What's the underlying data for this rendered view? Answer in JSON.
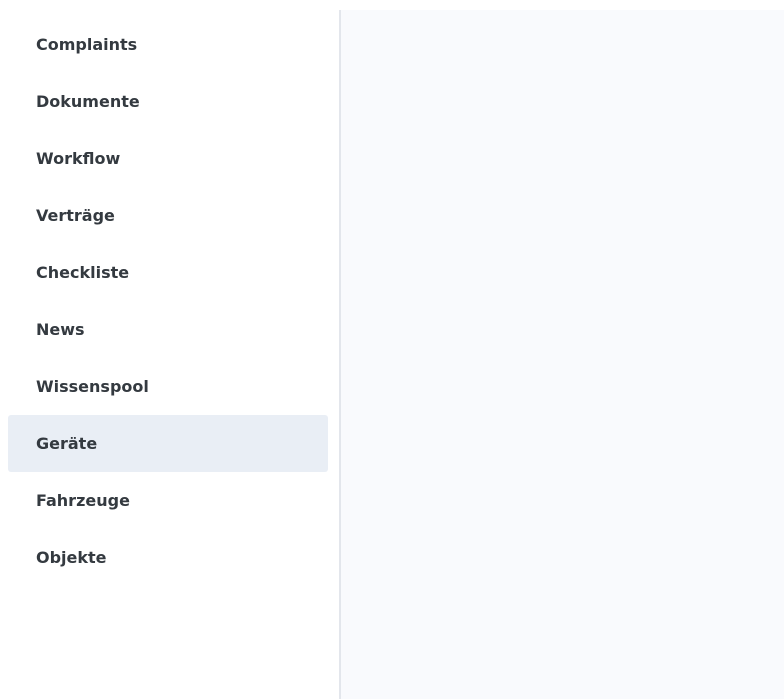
{
  "sidebar": {
    "items": [
      {
        "label": "Complaints"
      },
      {
        "label": "Dokumente"
      },
      {
        "label": "Workflow"
      },
      {
        "label": "Verträge"
      },
      {
        "label": "Checkliste"
      },
      {
        "label": "News"
      },
      {
        "label": "Wissenspool"
      },
      {
        "label": "Geräte",
        "active": true
      },
      {
        "label": "Fahrzeuge"
      },
      {
        "label": "Objekte"
      }
    ]
  },
  "colors": {
    "active_background": "#e9eef5",
    "main_background": "#f9fafd",
    "divider": "#e3e6ec",
    "text": "#343a40"
  }
}
